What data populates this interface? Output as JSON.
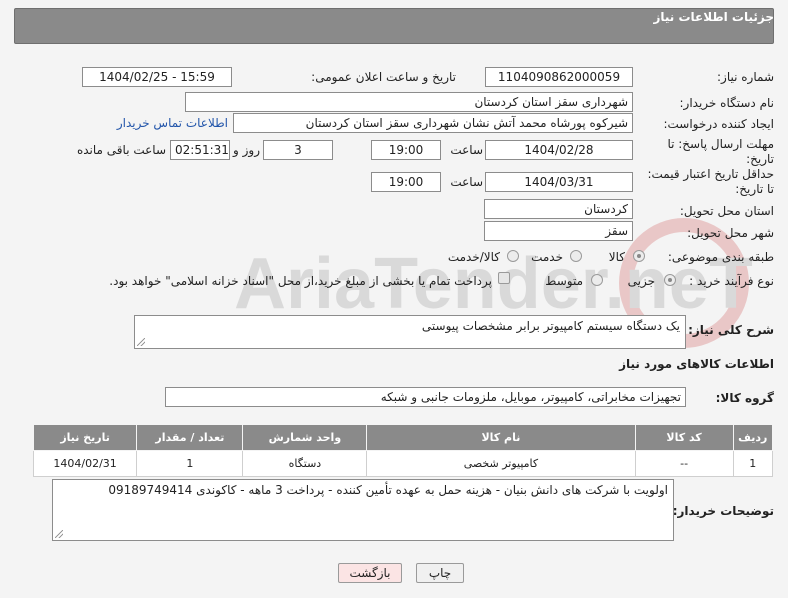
{
  "header": {
    "title": "جزئیات اطلاعات نیاز"
  },
  "labels": {
    "need_number": "شماره نیاز:",
    "announce_datetime": "تاریخ و ساعت اعلان عمومی:",
    "buyer_org": "نام دستگاه خریدار:",
    "creator": "ایجاد کننده درخواست:",
    "contact_link": "اطلاعات تماس خریدار",
    "reply_deadline": "مهلت ارسال پاسخ: تا تاریخ:",
    "hour": "ساعت",
    "day_and": "روز و",
    "remaining": "ساعت باقی مانده",
    "price_validity": "حداقل تاریخ اعتبار قیمت: تا تاریخ:",
    "delivery_province": "استان محل تحویل:",
    "delivery_city": "شهر محل تحویل:",
    "category": "طبقه بندی موضوعی:",
    "purchase_type": "نوع فرآیند خرید :",
    "need_description": "شرح کلی نیاز:",
    "goods_info": "اطلاعات کالاهای مورد نیاز",
    "goods_group": "گروه کالا:",
    "buyer_notes": "توضیحات خریدار:"
  },
  "values": {
    "need_number": "1104090862000059",
    "announce_datetime": "1404/02/25 - 15:59",
    "buyer_org": "شهرداری سقز استان کردستان",
    "creator": "شیرکوه پورشاه محمد آتش نشان شهرداری سقز استان کردستان",
    "reply_date": "1404/02/28",
    "reply_time": "19:00",
    "days": "3",
    "remaining_time": "02:51:31",
    "price_date": "1404/03/31",
    "price_time": "19:00",
    "province": "کردستان",
    "city": "سقز",
    "need_description": "یک دستگاه سیستم کامپیوتر برابر مشخصات پیوستی",
    "goods_group": "تجهیزات مخابراتی، کامپیوتر، موبایل، ملزومات جانبی و شبکه",
    "buyer_notes": "اولویت با شرکت های دانش بنیان - هزینه حمل به عهده تأمین کننده - پرداخت 3 ماهه - کاکوندی 09189749414"
  },
  "category_options": {
    "goods": "کالا",
    "service": "خدمت",
    "goods_service": "کالا/خدمت",
    "selected": "کالا"
  },
  "purchase_options": {
    "partial": "جزیی",
    "medium": "متوسط",
    "payment_note": "پرداخت تمام یا بخشی از مبلغ خرید،از محل \"اسناد خزانه اسلامی\" خواهد بود.",
    "selected": "جزیی"
  },
  "table": {
    "headers": [
      "ردیف",
      "کد کالا",
      "نام کالا",
      "واحد شمارش",
      "تعداد / مقدار",
      "تاریخ نیاز"
    ],
    "rows": [
      [
        "1",
        "--",
        "کامپیوتر شخصی",
        "دستگاه",
        "1",
        "1404/02/31"
      ]
    ]
  },
  "buttons": {
    "print": "چاپ",
    "back": "بازگشت"
  },
  "watermark": {
    "text": "AriaTender.neT"
  },
  "colors": {
    "header_bg": "#8a8a8a",
    "link": "#2255aa",
    "back_button": "#fbe4e4"
  }
}
